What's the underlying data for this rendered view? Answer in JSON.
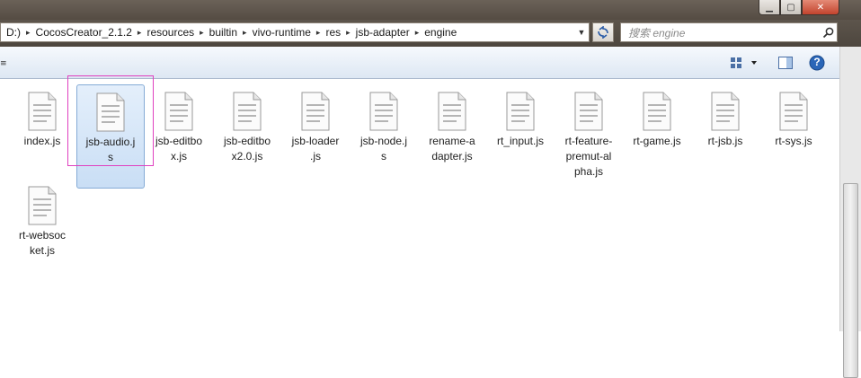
{
  "window": {
    "controls": {
      "minimize": "▁",
      "maximize": "▢",
      "close": "✕"
    }
  },
  "address_bar": {
    "crumbs": [
      "D:)",
      "CocosCreator_2.1.2",
      "resources",
      "builtin",
      "vivo-runtime",
      "res",
      "jsb-adapter",
      "engine"
    ],
    "separator": "▸",
    "dropdown_icon": "chevron-down-icon"
  },
  "search": {
    "placeholder": "搜索 engine"
  },
  "toolbar": {
    "left_glyph": "≡",
    "view_icon": "view-options-icon",
    "preview_icon": "preview-pane-icon",
    "help_icon": "help-icon",
    "help_label": "?"
  },
  "files": [
    {
      "name": "index.js",
      "selected": false
    },
    {
      "name": "jsb-audio.js",
      "selected": true
    },
    {
      "name": "jsb-editbox.js",
      "selected": false
    },
    {
      "name": "jsb-editbox2.0.js",
      "selected": false
    },
    {
      "name": "jsb-loader.js",
      "selected": false
    },
    {
      "name": "jsb-node.js",
      "selected": false
    },
    {
      "name": "rename-adapter.js",
      "selected": false
    },
    {
      "name": "rt_input.js",
      "selected": false
    },
    {
      "name": "rt-feature-premut-alpha.js",
      "selected": false
    },
    {
      "name": "rt-game.js",
      "selected": false
    },
    {
      "name": "rt-jsb.js",
      "selected": false
    },
    {
      "name": "rt-sys.js",
      "selected": false
    },
    {
      "name": "rt-websocket.js",
      "selected": false
    }
  ],
  "file_labels_wrapped": [
    "index.js",
    "jsb-audio.j\ns",
    "jsb-editbo\nx.js",
    "jsb-editbo\nx2.0.js",
    "jsb-loader\n.js",
    "jsb-node.j\ns",
    "rename-a\ndapter.js",
    "rt_input.js",
    "rt-feature-\npremut-al\npha.js",
    "rt-game.js",
    "rt-jsb.js",
    "rt-sys.js",
    "rt-websoc\nket.js"
  ]
}
